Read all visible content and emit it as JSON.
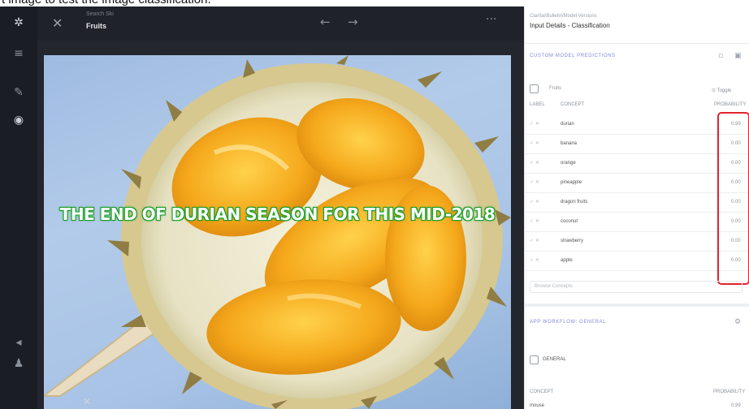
{
  "caption": "t image to test the image classification.",
  "topbar": {
    "subtitle": "Search Ski",
    "title": "Fruits",
    "back_icon": "←",
    "forward_icon": "→",
    "more_icon": "···",
    "close_icon": "✕"
  },
  "sidebar": {
    "icons": [
      "app-logo-icon",
      "menu-icon",
      "edit-icon",
      "eye-icon",
      "megaphone-icon",
      "user-icon"
    ]
  },
  "image": {
    "overlay_text": "THE END OF DURIAN SEASON FOR THIS MID-2018"
  },
  "panel": {
    "breadcrumb": "Clarifai/Bulletin/Model Versions",
    "title": "Input Details - Classification",
    "custom_section": {
      "title": "CUSTOM MODEL PREDICTIONS",
      "select_label": "Fruits",
      "toggle_label": "⊙ Toggle",
      "col_label": "LABEL",
      "col_concept": "CONCEPT",
      "col_prob": "PROBABILITY",
      "rows": [
        {
          "concept": "durian",
          "prob": "0.99"
        },
        {
          "concept": "banana",
          "prob": "0.00"
        },
        {
          "concept": "orange",
          "prob": "0.00"
        },
        {
          "concept": "pineapple",
          "prob": "0.00"
        },
        {
          "concept": "dragon fruits",
          "prob": "0.00"
        },
        {
          "concept": "coconut",
          "prob": "0.00"
        },
        {
          "concept": "strawberry",
          "prob": "0.00"
        },
        {
          "concept": "apple",
          "prob": "0.00"
        }
      ],
      "add_placeholder": "Browse Concepts"
    },
    "general_section": {
      "title": "APP WORKFLOW: GENERAL",
      "checkbox_label": "GENERAL",
      "col_concept": "CONCEPT",
      "col_prob": "PROBABILITY",
      "first_concept": "mouse",
      "first_prob": "0.99"
    }
  },
  "colors": {
    "sidebar_bg": "#1a1d23",
    "highlight": "#e0242c",
    "section_accent": "#7f8bd9"
  }
}
